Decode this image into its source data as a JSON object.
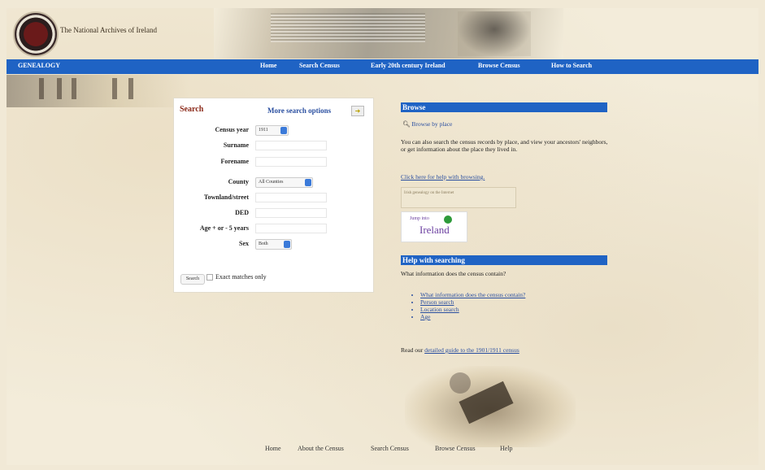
{
  "header": {
    "site_title": "The National Archives of Ireland"
  },
  "navbar": {
    "section": "GENEALOGY",
    "items": [
      "Home",
      "Search Census",
      "Early 20th century Ireland",
      "Browse Census",
      "How to Search"
    ]
  },
  "search": {
    "title": "Search",
    "more_options": "More search options",
    "labels": {
      "census_year": "Census year",
      "surname": "Surname",
      "forename": "Forename",
      "county": "County",
      "townland": "Townland/street",
      "ded": "DED",
      "age": "Age + or - 5 years",
      "sex": "Sex"
    },
    "census_year_value": "1911",
    "county_value": "All Counties",
    "sex_value": "Both",
    "search_button": "Search",
    "exact_matches": "Exact matches only"
  },
  "browse": {
    "title": "Browse",
    "browse_by_place": "Browse by place",
    "description": "You can also search the census records by place, and view your ancestors' neighbors, or get information about the place they lived in.",
    "help_link": "Click here for help with browsing.",
    "badge_text": "Irish genealogy on the Internet",
    "ireland_small": "Jump into",
    "ireland_big": "Ireland"
  },
  "help": {
    "title": "Help with searching",
    "intro": "What information does the census contain?",
    "links": [
      "What information does the census contain?",
      "Person search",
      "Location search",
      "Age"
    ],
    "read_our": "Read our",
    "guide_link": "detailed guide to the 1901/1911 census"
  },
  "footer": {
    "links": [
      "Home",
      "About the Census",
      "Search Census",
      "Browse Census",
      "Help"
    ]
  }
}
